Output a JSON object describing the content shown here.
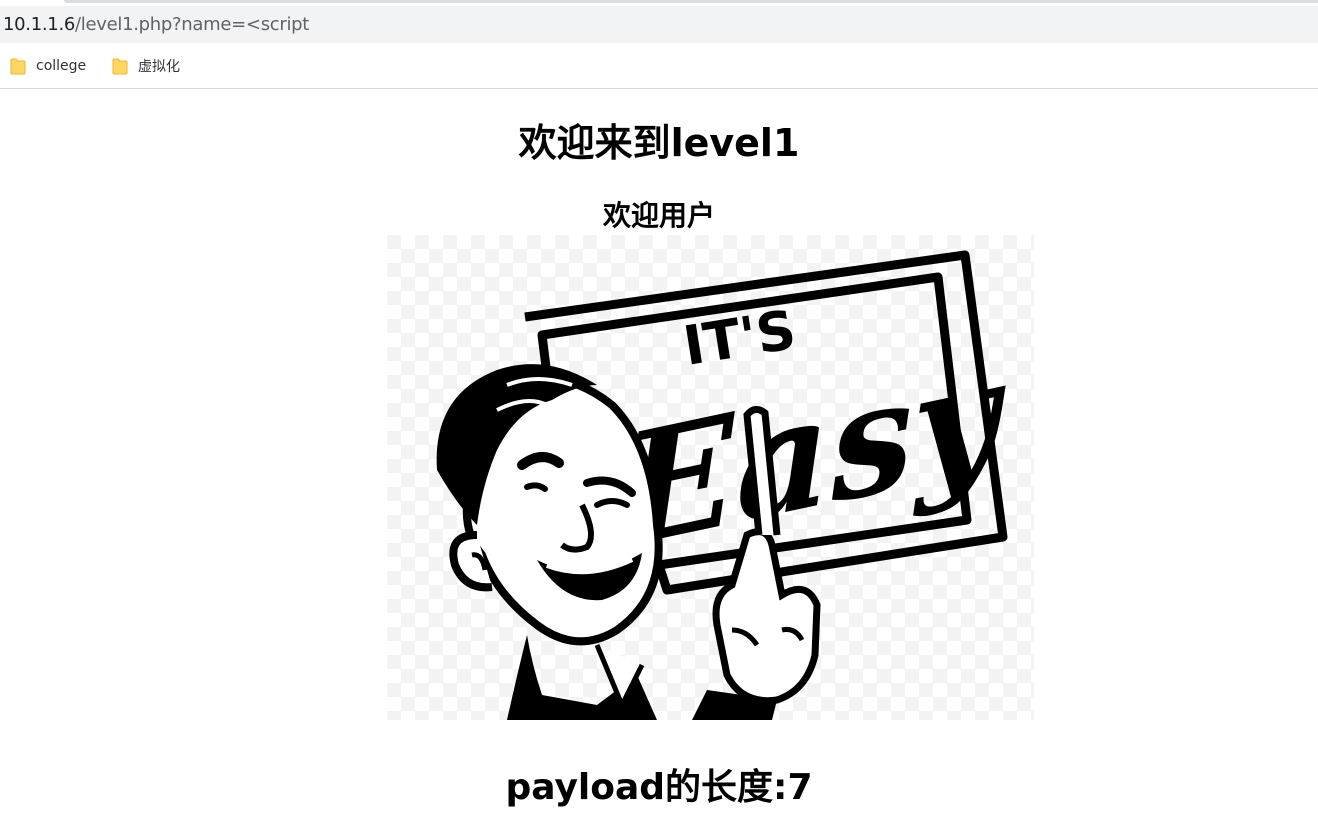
{
  "browser": {
    "url_host": "10.1.1.6",
    "url_path": "/level1.php?name=<script"
  },
  "bookmarks": [
    {
      "label": "college",
      "icon": "folder-icon"
    },
    {
      "label": "虚拟化",
      "icon": "folder-icon"
    }
  ],
  "page": {
    "heading": "欢迎来到level1",
    "subheading": "欢迎用户",
    "image": {
      "sign_text_top": "IT'S",
      "sign_text_script": "Easy"
    },
    "payload_length_text": "payload的长度:7"
  },
  "colors": {
    "folder": "#fdd663",
    "folder_edge": "#e8b923",
    "addressbar": "#f1f3f4"
  }
}
